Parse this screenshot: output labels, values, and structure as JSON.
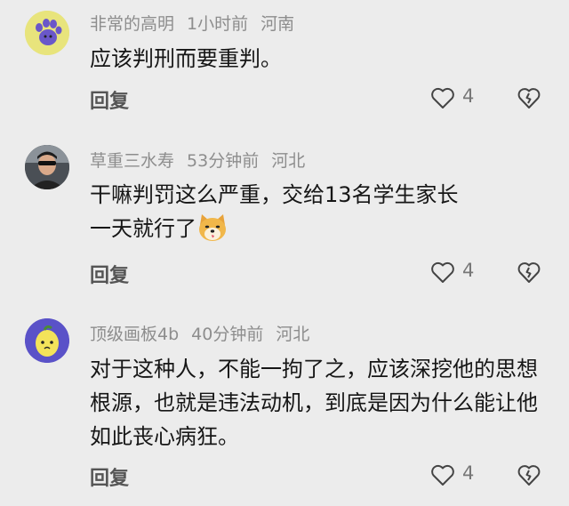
{
  "comments": [
    {
      "author": "非常的高明",
      "time": "1小时前",
      "location": "河南",
      "text": "应该判刑而要重判。",
      "reply_label": "回复",
      "likes": "4",
      "avatar_icon": "paw-avatar-icon"
    },
    {
      "author": "草重三水寿",
      "time": "53分钟前",
      "location": "河北",
      "text_line1": "干嘛判罚这么严重，交给13名学生家长",
      "text_line2": "一天就行了",
      "emoji_icon": "doge-emoji-icon",
      "reply_label": "回复",
      "likes": "4",
      "avatar_icon": "man-photo-avatar"
    },
    {
      "author": "顶级画板4b",
      "time": "40分钟前",
      "location": "河北",
      "text": "对于这种人，不能一拘了之，应该深挖他的思想根源，也就是违法动机，到底是因为什么能让他如此丧心病狂。",
      "reply_label": "回复",
      "likes": "4",
      "avatar_icon": "lemon-avatar-icon"
    }
  ],
  "colors": {
    "background": "#ececec",
    "meta_text": "#8d8d8d",
    "body_text": "#161616",
    "avatar1_bg": "#e3e27a",
    "avatar3_bg": "#5a52c8"
  }
}
